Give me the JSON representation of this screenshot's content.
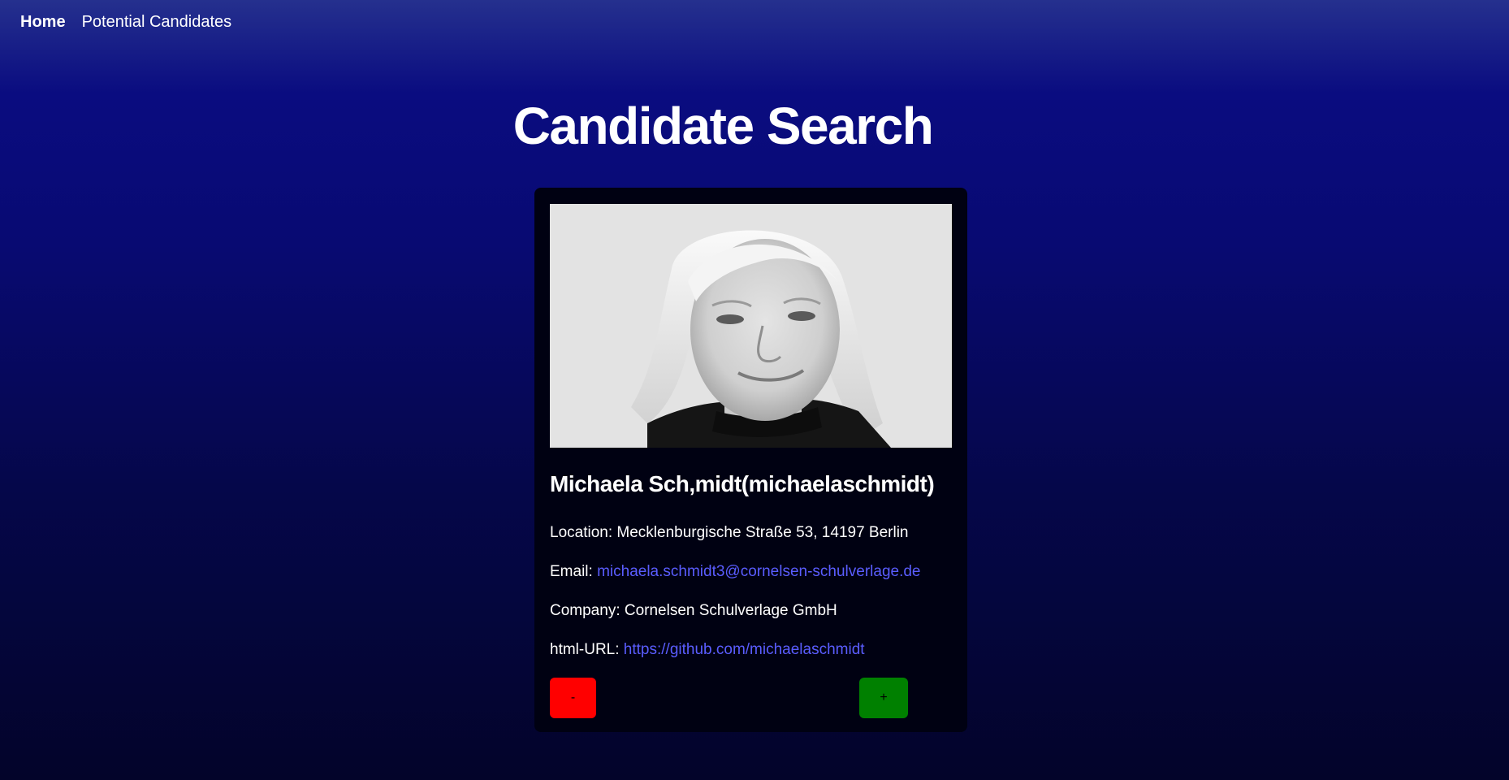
{
  "nav": {
    "home": "Home",
    "potential": "Potential Candidates"
  },
  "page": {
    "title": "Candidate Search"
  },
  "candidate": {
    "name_line": "Michaela Sch,midt(michaelaschmidt)",
    "location_label": "Location: ",
    "location": "Mecklenburgische Straße 53, 14197 Berlin",
    "email_label": "Email: ",
    "email": "michaela.schmidt3@cornelsen-schulverlage.de",
    "company_label": "Company: ",
    "company": "Cornelsen Schulverlage GmbH",
    "url_label": "html-URL: ",
    "url": "https://github.com/michaelaschmidt"
  },
  "actions": {
    "reject": "-",
    "accept": "+"
  },
  "colors": {
    "link": "#5a5dff",
    "reject": "#ff0000",
    "accept": "#008000"
  }
}
